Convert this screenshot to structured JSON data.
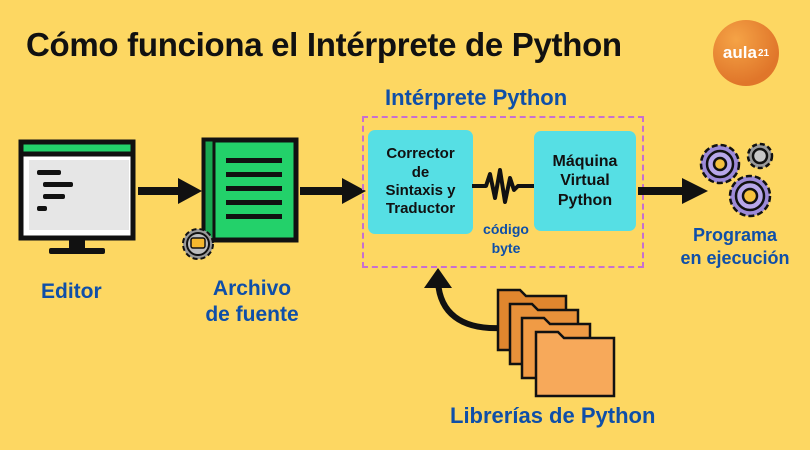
{
  "title": "Cómo funciona el Intérprete de Python",
  "logo": {
    "text": "aula",
    "sup": "21"
  },
  "interpreter": {
    "title": "Intérprete Python",
    "corrector": [
      "Corrector",
      "de",
      "Sintaxis y",
      "Traductor"
    ],
    "maquina": [
      "Máquina",
      "Virtual",
      "Python"
    ],
    "bytecode": [
      "código",
      "byte"
    ]
  },
  "labels": {
    "editor": "Editor",
    "archivo": [
      "Archivo",
      "de fuente"
    ],
    "programa": [
      "Programa",
      "en ejecución"
    ],
    "librerias": "Librerías de Python"
  },
  "colors": {
    "background": "#fdd762",
    "accent_blue": "#0f4fa8",
    "cyan": "#56dfe4",
    "green": "#23d16a",
    "orange": "#f5a346",
    "dashed": "#c86fd0"
  },
  "icons": {
    "editor": "monitor-icon",
    "archivo": "document-icon",
    "archivo_badge": "gear-icon",
    "programa": "gears-icon",
    "librerias": "folders-icon",
    "loop_arrow": "curved-arrow-icon",
    "bytecode_wave": "signal-wave-icon"
  }
}
